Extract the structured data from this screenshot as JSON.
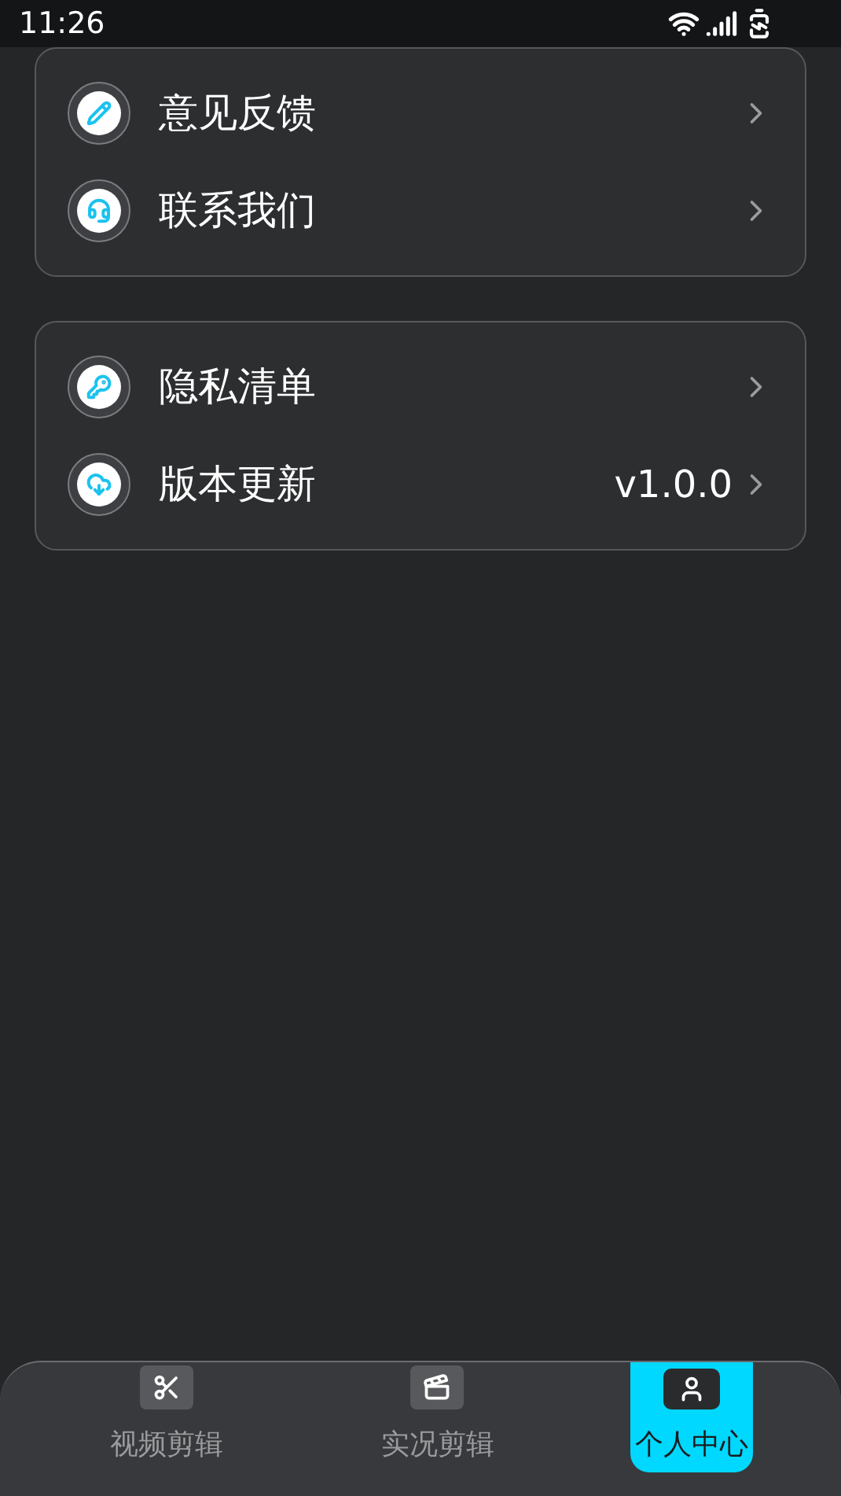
{
  "status_bar": {
    "time": "11:26"
  },
  "groups": [
    {
      "items": [
        {
          "label": "意见反馈"
        },
        {
          "label": "联系我们"
        }
      ]
    },
    {
      "items": [
        {
          "label": "隐私清单"
        },
        {
          "label": "版本更新",
          "value": "v1.0.0"
        }
      ]
    }
  ],
  "bottom_nav": [
    {
      "label": "视频剪辑",
      "selected": false
    },
    {
      "label": "实况剪辑",
      "selected": false
    },
    {
      "label": "个人中心",
      "selected": true
    }
  ]
}
